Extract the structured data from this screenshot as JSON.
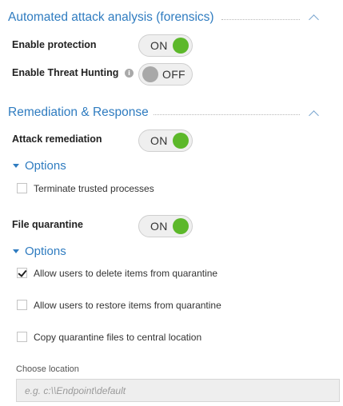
{
  "forensics": {
    "title": "Automated attack analysis (forensics)",
    "enable_protection": {
      "label": "Enable protection",
      "state": "ON"
    },
    "threat_hunting": {
      "label": "Enable Threat Hunting",
      "state": "OFF",
      "info_glyph": "i"
    }
  },
  "remediation": {
    "title": "Remediation & Response",
    "attack_remediation": {
      "label": "Attack remediation",
      "state": "ON"
    },
    "options_1": {
      "heading": "Options",
      "items": [
        {
          "label": "Terminate trusted processes",
          "checked": false
        }
      ]
    },
    "file_quarantine": {
      "label": "File quarantine",
      "state": "ON"
    },
    "options_2": {
      "heading": "Options",
      "items": [
        {
          "label": "Allow users to delete items from quarantine",
          "checked": true
        },
        {
          "label": "Allow users to restore items from quarantine",
          "checked": false
        },
        {
          "label": "Copy quarantine files to central location",
          "checked": false
        }
      ]
    },
    "location": {
      "label": "Choose location",
      "placeholder": "e.g. c:\\\\Endpoint\\default",
      "value": ""
    }
  },
  "colors": {
    "accent": "#2f7cc0",
    "toggle_on": "#5cb82a",
    "toggle_off": "#a8a8a8"
  },
  "icons": {
    "collapse": "chevron-up-icon",
    "expand": "caret-down-icon",
    "info": "info-icon",
    "check": "checkmark-icon"
  }
}
